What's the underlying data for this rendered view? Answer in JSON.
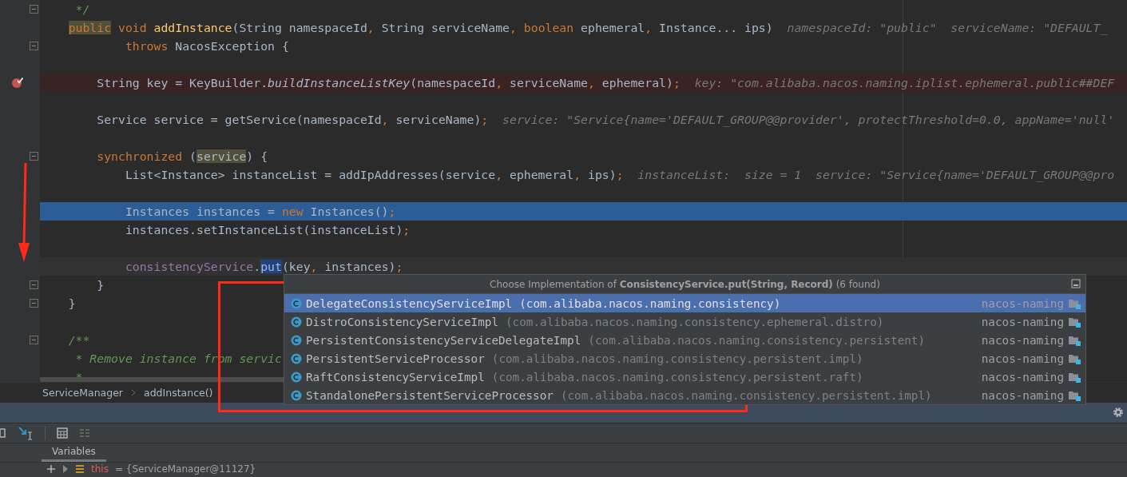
{
  "editor": {
    "lines": [
      {
        "fold": true,
        "tokens": [
          {
            "kind": "doc",
            "text": " */"
          }
        ]
      },
      {
        "fold": false,
        "tokens": [
          {
            "kind": "kw-marked",
            "text": "public"
          },
          {
            "kind": "kw",
            "text": " void"
          },
          {
            "kind": "method",
            "text": " addInstance"
          },
          {
            "kind": "plain",
            "text": "(String namespaceId"
          },
          {
            "kind": "kw",
            "text": ","
          },
          {
            "kind": "plain",
            "text": " String serviceName"
          },
          {
            "kind": "kw",
            "text": ","
          },
          {
            "kind": "kw",
            "text": " boolean"
          },
          {
            "kind": "plain",
            "text": " ephemeral"
          },
          {
            "kind": "kw",
            "text": ","
          },
          {
            "kind": "plain",
            "text": " Instance... ips)"
          }
        ],
        "hint": "namespaceId: \"public\"  serviceName: \"DEFAULT_",
        "children": [
          {
            "kind": "continuation",
            "fold": true,
            "tokens": [
              {
                "kind": "kw",
                "text": "throws"
              },
              {
                "kind": "plain",
                "text": " NacosException {"
              }
            ]
          },
          {
            "fold": false
          },
          {
            "kind": "breakpoint",
            "fold": false,
            "tokens": [
              {
                "kind": "plain",
                "text": "String key = KeyBuilder."
              },
              {
                "kind": "static",
                "text": "buildInstanceListKey"
              },
              {
                "kind": "plain",
                "text": "(namespaceId"
              },
              {
                "kind": "kw",
                "text": ","
              },
              {
                "kind": "plain",
                "text": " serviceName"
              },
              {
                "kind": "kw",
                "text": ","
              },
              {
                "kind": "plain",
                "text": " ephemeral)"
              },
              {
                "kind": "kw",
                "text": ";"
              }
            ],
            "hint": "key: \"com.alibaba.nacos.naming.iplist.ephemeral.public##DEF"
          },
          {
            "fold": false
          },
          {
            "fold": false,
            "tokens": [
              {
                "kind": "plain",
                "text": "Service service = getService(namespaceId"
              },
              {
                "kind": "kw",
                "text": ","
              },
              {
                "kind": "plain",
                "text": " serviceName)"
              },
              {
                "kind": "kw",
                "text": ";"
              }
            ],
            "hint": "service: \"Service{name='DEFAULT_GROUP@@provider', protectThreshold=0.0, appName='null'"
          },
          {
            "fold": false
          },
          {
            "fold": true,
            "tokens": [
              {
                "kind": "kw",
                "text": "synchronized"
              },
              {
                "kind": "plain",
                "text": " ("
              },
              {
                "kind": "plain-marked",
                "text": "service"
              },
              {
                "kind": "plain",
                "text": ") {"
              }
            ],
            "children": [
              {
                "fold": false,
                "tokens": [
                  {
                    "kind": "plain",
                    "text": "List<Instance> instanceList = addIpAddresses(service"
                  },
                  {
                    "kind": "kw",
                    "text": ","
                  },
                  {
                    "kind": "plain",
                    "text": " ephemeral"
                  },
                  {
                    "kind": "kw",
                    "text": ","
                  },
                  {
                    "kind": "plain",
                    "text": " ips)"
                  },
                  {
                    "kind": "kw",
                    "text": ";"
                  }
                ],
                "hint": "instanceList:  size = 1  service: \"Service{name='DEFAULT_GROUP@@pro"
              },
              {
                "fold": false
              },
              {
                "kind": "execution",
                "fold": false,
                "tokens": [
                  {
                    "kind": "plain",
                    "text": "Instances instances = "
                  },
                  {
                    "kind": "kw",
                    "text": "new"
                  },
                  {
                    "kind": "plain",
                    "text": " Instances()"
                  },
                  {
                    "kind": "kw",
                    "text": ";"
                  }
                ]
              },
              {
                "fold": false,
                "tokens": [
                  {
                    "kind": "plain",
                    "text": "instances.setInstanceList(instanceList)"
                  },
                  {
                    "kind": "kw",
                    "text": ";"
                  }
                ]
              },
              {
                "fold": false
              },
              {
                "kind": "caret",
                "fold": false,
                "tokens": [
                  {
                    "kind": "field",
                    "text": "consistencyService"
                  },
                  {
                    "kind": "plain",
                    "text": "."
                  },
                  {
                    "kind": "selected",
                    "text": "put"
                  },
                  {
                    "kind": "plain",
                    "text": "(key"
                  },
                  {
                    "kind": "kw",
                    "text": ","
                  },
                  {
                    "kind": "plain",
                    "text": " instances)"
                  },
                  {
                    "kind": "kw",
                    "text": ";"
                  }
                ]
              }
            ]
          },
          {
            "fold": true,
            "tokens": [
              {
                "kind": "plain",
                "text": "}"
              }
            ]
          }
        ]
      },
      {
        "fold": true,
        "tokens": [
          {
            "kind": "plain",
            "text": "}"
          }
        ]
      },
      {
        "fold": false
      },
      {
        "fold": true,
        "tokens": [
          {
            "kind": "doc",
            "text": "/**"
          }
        ]
      },
      {
        "fold": false,
        "tokens": [
          {
            "kind": "doc",
            "text": " * Remove instance from servic"
          }
        ]
      },
      {
        "fold": false,
        "tokens": [
          {
            "kind": "doc",
            "text": " *"
          }
        ]
      }
    ]
  },
  "popup": {
    "title": "Choose Implementation of **ConsistencyService.put(String, Record)** (6 found)",
    "items": [
      {
        "name": "DelegateConsistencyServiceImpl",
        "package": "(com.alibaba.nacos.naming.consistency)",
        "module": "nacos-naming",
        "selected": true
      },
      {
        "name": "DistroConsistencyServiceImpl",
        "package": "(com.alibaba.nacos.naming.consistency.ephemeral.distro)",
        "module": "nacos-naming",
        "selected": false
      },
      {
        "name": "PersistentConsistencyServiceDelegateImpl",
        "package": "(com.alibaba.nacos.naming.consistency.persistent)",
        "module": "nacos-naming",
        "selected": false
      },
      {
        "name": "PersistentServiceProcessor",
        "package": "(com.alibaba.nacos.naming.consistency.persistent.impl)",
        "module": "nacos-naming",
        "selected": false
      },
      {
        "name": "RaftConsistencyServiceImpl",
        "package": "(com.alibaba.nacos.naming.consistency.persistent.raft)",
        "module": "nacos-naming",
        "selected": false
      },
      {
        "name": "StandalonePersistentServiceProcessor",
        "package": "(com.alibaba.nacos.naming.consistency.persistent.impl)",
        "module": "nacos-naming",
        "selected": false
      }
    ]
  },
  "breadcrumbs": [
    "ServiceManager",
    "addInstance()"
  ],
  "debug": {
    "tabs": [
      {
        "label": "Variables",
        "selected": true
      }
    ],
    "variables": [
      {
        "name": "this",
        "value": "= {ServiceManager@11127}"
      }
    ]
  }
}
